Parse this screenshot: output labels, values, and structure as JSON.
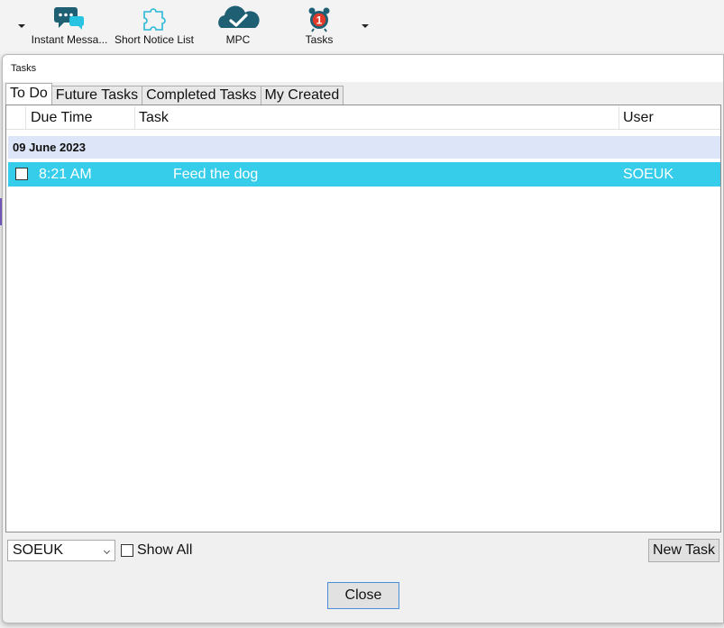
{
  "toolbar": {
    "buttons": [
      {
        "label": "Instant Messa...",
        "icon": "chat-bubbles-icon"
      },
      {
        "label": "Short Notice List",
        "icon": "puzzle-piece-icon"
      },
      {
        "label": "MPC",
        "icon": "cloud-check-icon"
      },
      {
        "label": "Tasks",
        "icon": "alarm-clock-icon",
        "badge": "1"
      }
    ]
  },
  "dialog": {
    "title": "Tasks",
    "tabs": [
      {
        "label": "To Do",
        "active": true
      },
      {
        "label": "Future Tasks",
        "active": false
      },
      {
        "label": "Completed Tasks",
        "active": false
      },
      {
        "label": "My Created",
        "active": false
      }
    ],
    "grid": {
      "columns": [
        "Due Time",
        "Task",
        "User"
      ],
      "groups": [
        {
          "date": "09 June 2023",
          "rows": [
            {
              "checked": false,
              "due_time": "8:21 AM",
              "task": "Feed the dog",
              "user": "SOEUK",
              "selected": true
            }
          ]
        }
      ]
    },
    "user_select": {
      "value": "SOEUK"
    },
    "show_all": {
      "label": "Show All",
      "checked": false
    },
    "new_task_label": "New Task",
    "close_label": "Close"
  },
  "colors": {
    "selected_row": "#35cdea",
    "group_row": "#dde5f8",
    "icon_teal": "#1f5f74",
    "badge_red": "#e23a2a"
  }
}
